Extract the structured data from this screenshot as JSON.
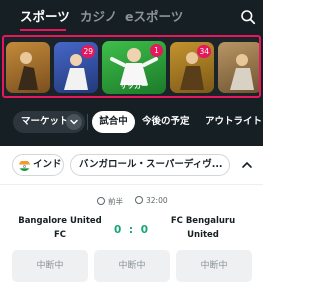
{
  "top_tabs": [
    {
      "label": "スポーツ",
      "active": true
    },
    {
      "label": "カジノ",
      "active": false
    },
    {
      "label": "eスポーツ",
      "active": false
    }
  ],
  "carousel": {
    "tiles": [
      {
        "name": "tile-1",
        "badge": ""
      },
      {
        "name": "tile-2",
        "badge": "29"
      },
      {
        "name": "soccer",
        "badge": "1",
        "label": "サッカー"
      },
      {
        "name": "tile-4",
        "badge": "34"
      },
      {
        "name": "tile-5",
        "badge": ""
      }
    ]
  },
  "filters": {
    "market_label": "マーケット",
    "items": [
      "試合中",
      "今後の予定",
      "アウトライト"
    ]
  },
  "event_group": {
    "country": "インド",
    "league": "バンガロール・スーパーディヴ..."
  },
  "match": {
    "period": "前半",
    "clock": "32:00",
    "home_team": "Bangalore United FC",
    "away_team": "FC Bengaluru United",
    "score": "0 : 0",
    "odds": [
      "中断中",
      "中断中",
      "中断中"
    ]
  },
  "colors": {
    "accent": "#e6175c",
    "score_green": "#17a673",
    "header_bg": "#161f24"
  }
}
